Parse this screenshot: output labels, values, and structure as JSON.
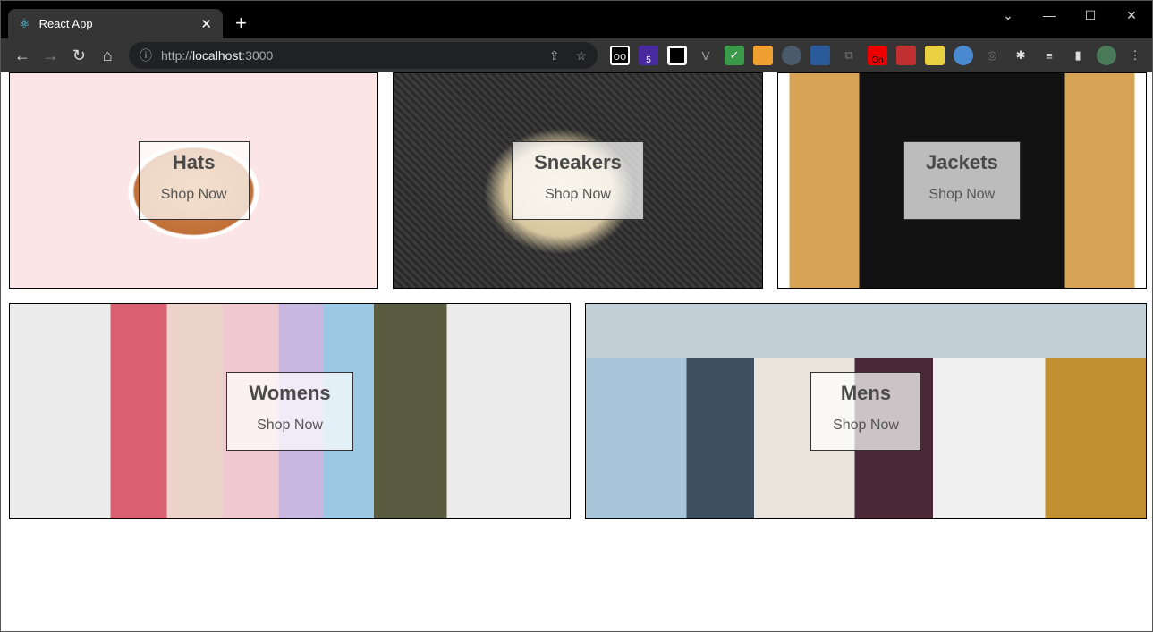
{
  "browser": {
    "tab_title": "React App",
    "url_scheme": "http://",
    "url_host": "localhost",
    "url_port": ":3000",
    "extension_badge_count": "5",
    "extension_on_label": "On"
  },
  "categories": [
    {
      "title": "Hats",
      "cta": "Shop Now"
    },
    {
      "title": "Sneakers",
      "cta": "Shop Now"
    },
    {
      "title": "Jackets",
      "cta": "Shop Now"
    },
    {
      "title": "Womens",
      "cta": "Shop Now"
    },
    {
      "title": "Mens",
      "cta": "Shop Now"
    }
  ]
}
